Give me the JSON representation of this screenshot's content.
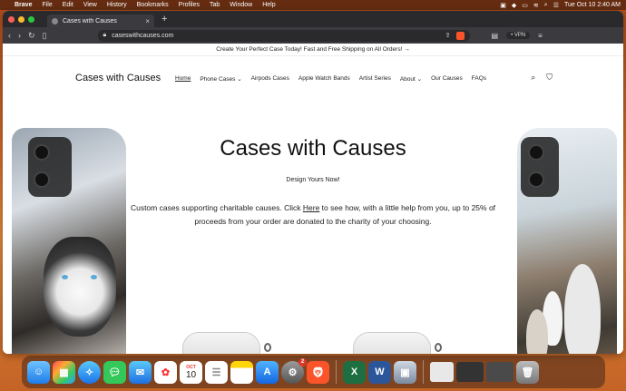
{
  "menubar": {
    "app": "Brave",
    "items": [
      "File",
      "Edit",
      "View",
      "History",
      "Bookmarks",
      "Profiles",
      "Tab",
      "Window",
      "Help"
    ],
    "clock": "Tue Oct 10  2:40 AM"
  },
  "browser": {
    "tab_title": "Cases with Causes",
    "url": "caseswithcauses.com",
    "vpn_label": "• VPN",
    "shield_badge": "0"
  },
  "site": {
    "announcement": "Create Your Perfect Case Today! Fast and Free Shipping on All Orders!  →",
    "logo": "Cases with Causes",
    "nav": [
      "Home",
      "Phone Cases",
      "Airpods Cases",
      "Apple Watch Bands",
      "Artist Series",
      "About",
      "Our Causes",
      "FAQs"
    ],
    "hero": {
      "title": "Cases with Causes",
      "subtitle": "Design Yours Now!",
      "desc_before": "Custom cases supporting charitable causes. Click ",
      "desc_link": "Here",
      "desc_after": " to see how, with a little help from you, up to 25% of proceeds from your order are donated to the charity of your choosing."
    }
  },
  "dock": {
    "calendar_month": "OCT",
    "calendar_day": "10",
    "settings_badge": "2"
  },
  "colors": {
    "accent_brave": "#fb542b",
    "traffic_red": "#ff5f57",
    "traffic_yellow": "#febc2e",
    "traffic_green": "#28c840"
  }
}
